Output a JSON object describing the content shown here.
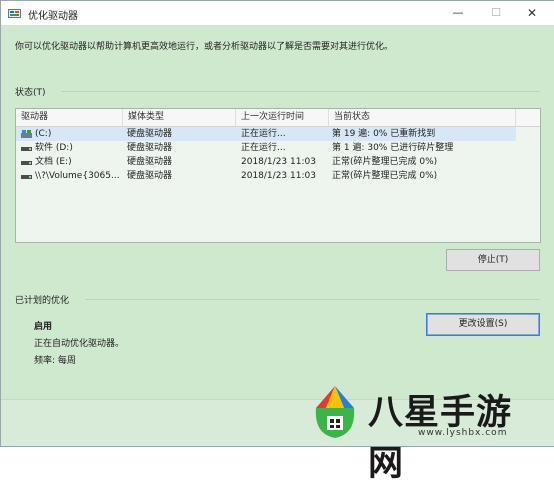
{
  "window": {
    "title": "优化驱动器",
    "controls": {
      "minimize": "—",
      "maximize": "☐",
      "close": "✕"
    }
  },
  "description": "你可以优化驱动器以帮助计算机更高效地运行，或者分析驱动器以了解是否需要对其进行优化。",
  "status_section": {
    "label": "状态(T)",
    "columns": [
      "驱动器",
      "媒体类型",
      "上一次运行时间",
      "当前状态"
    ],
    "rows": [
      {
        "drive": "(C:)",
        "media": "硬盘驱动器",
        "last_run": "正在运行...",
        "status": "第 19 遍: 0% 已重新找到",
        "selected": true
      },
      {
        "drive": "软件 (D:)",
        "media": "硬盘驱动器",
        "last_run": "正在运行...",
        "status": "第 1 遍: 30% 已进行碎片整理",
        "selected": false
      },
      {
        "drive": "文档 (E:)",
        "media": "硬盘驱动器",
        "last_run": "2018/1/23 11:03",
        "status": "正常(碎片整理已完成 0%)",
        "selected": false
      },
      {
        "drive": "\\\\?\\Volume{3065...",
        "media": "硬盘驱动器",
        "last_run": "2018/1/23 11:03",
        "status": "正常(碎片整理已完成 0%)",
        "selected": false
      }
    ],
    "stop_button": "停止(T)"
  },
  "scheduled": {
    "label": "已计划的优化",
    "state": "启用",
    "detail": "正在自动优化驱动器。",
    "frequency": "频率: 每周",
    "change_button": "更改设置(S)"
  },
  "watermark": {
    "text": "八星手游网",
    "url": "www.lyshbx.com"
  },
  "colors": {
    "window_bg": "#cfe9cf",
    "selected_row": "#d7e7f7",
    "logo_red": "#e23b2e",
    "logo_yellow": "#f5c40a",
    "logo_green": "#3bb54a",
    "logo_blue": "#2a7fd4"
  }
}
